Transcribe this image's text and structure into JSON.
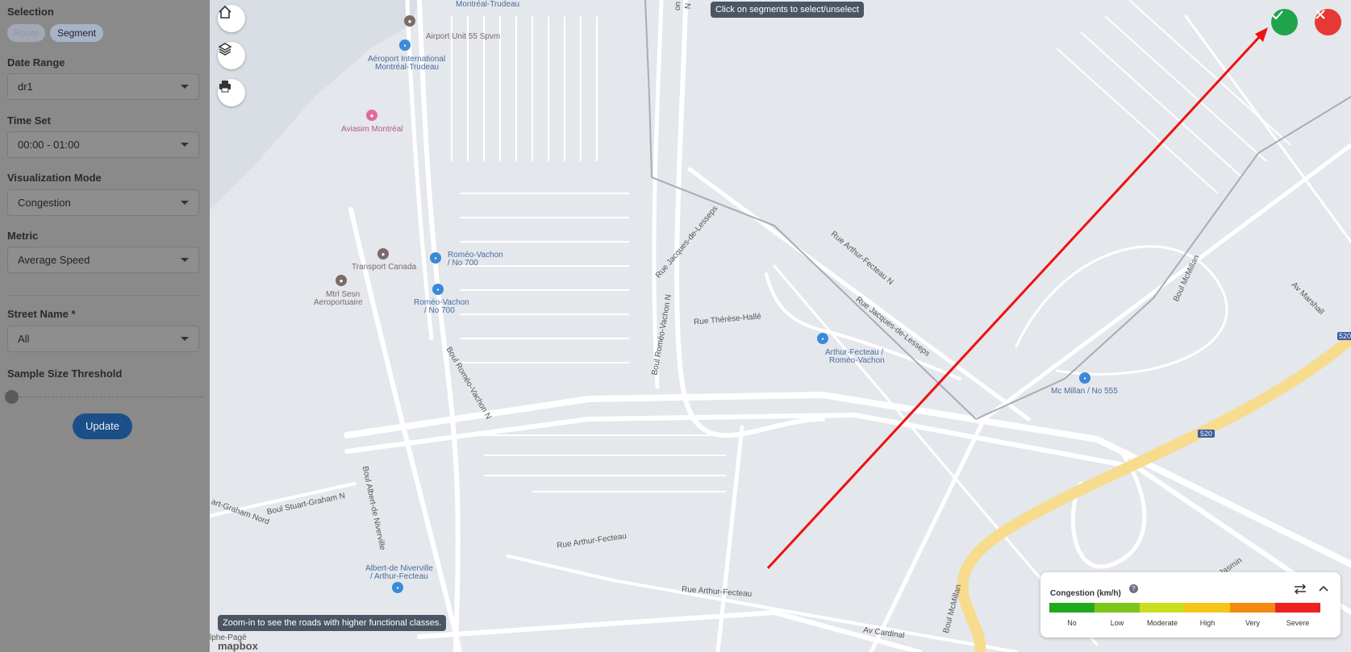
{
  "sidebar": {
    "selection_label": "Selection",
    "route_label": "Route",
    "segment_label": "Segment",
    "date_range_label": "Date Range",
    "date_range_value": "dr1",
    "time_set_label": "Time Set",
    "time_set_value": "00:00 - 01:00",
    "viz_mode_label": "Visualization Mode",
    "viz_mode_value": "Congestion",
    "metric_label": "Metric",
    "metric_value": "Average Speed",
    "street_name_label": "Street Name *",
    "street_name_value": "All",
    "sample_size_label": "Sample Size Threshold",
    "update_label": "Update"
  },
  "map": {
    "tooltip_top": "Click on segments to select/unselect",
    "tooltip_bottom": "Zoom-in to see the roads with higher functional classes.",
    "attribution": "mapbox",
    "labels": {
      "montreal_trudeau": "Montréal-Trudeau",
      "airport_unit": "Airport Unit 55 Spvm",
      "aeroport_1": "Aéroport International",
      "aeroport_2": "Montréal-Trudeau",
      "aviasim": "Aviasim Montréal",
      "transport_canada": "Transport Canada",
      "romeo_vachon_700_1a": "Roméo-Vachon",
      "romeo_vachon_700_1b": "/ No 700",
      "romeo_vachon_700_2a": "Roméo-Vachon",
      "romeo_vachon_700_2b": "/ No 700",
      "mtrl_sesn_1": "Mtrl Sesn",
      "mtrl_sesn_2": "Aeroportuaire",
      "boul_romeo_vachon_n": "Boul Roméo-Vachon N",
      "boul_romeo_vachon_n2": "Boul Roméo-Vachon N",
      "rue_jacques_de_lesseps": "Rue Jacques-de-Lesseps",
      "rue_jacques_de_lesseps2": "Rue Jacques-de-Lesseps",
      "rue_arthur_fecteau_n": "Rue Arthur-Fecteau N",
      "rue_therese_halle": "Rue Thérèse-Hallé",
      "arthur_fecteau_stop_1": "Arthur-Fecteau /",
      "arthur_fecteau_stop_2": "Roméo-Vachon",
      "mcmillan_555": "Mc Millan / No 555",
      "boul_mcmillan": "Boul McMillan",
      "av_marshall": "Av Marshall",
      "boul_stuart_graham": "Boul Stuart-Graham N",
      "art_graham": "art-Graham Nord",
      "boul_albert": "Boul Albert-de Niverville",
      "rue_arthur_fecteau": "Rue Arthur-Fecteau",
      "rue_arthur_fecteau2": "Rue Arthur-Fecteau",
      "albert_stop_1": "Albert-de Niverville",
      "albert_stop_2": "/ Arthur-Fecteau",
      "av_cardinal": "Av Cardinal",
      "boul_mcmillan2": "Boul McMillan",
      "alphe_page": "lphe-Pagé",
      "jasmin": "Jasmin",
      "hwy_520": "520",
      "hwy_520b": "520",
      "partial_n": "N",
      "partial_on": "on"
    }
  },
  "legend": {
    "title": "Congestion (km/h)",
    "help": "?",
    "levels": [
      {
        "label": "No",
        "color": "#22a91b"
      },
      {
        "label": "Low",
        "color": "#7cc51a"
      },
      {
        "label": "Moderate",
        "color": "#c9df1d"
      },
      {
        "label": "High",
        "color": "#f5c518"
      },
      {
        "label": "Very",
        "color": "#f28a12"
      },
      {
        "label": "Severe",
        "color": "#ee2020"
      }
    ]
  },
  "colors": {
    "confirm": "#20a34a",
    "cancel": "#e53935",
    "annotation_arrow": "#ee1111",
    "highway": "#f7dc8e"
  }
}
